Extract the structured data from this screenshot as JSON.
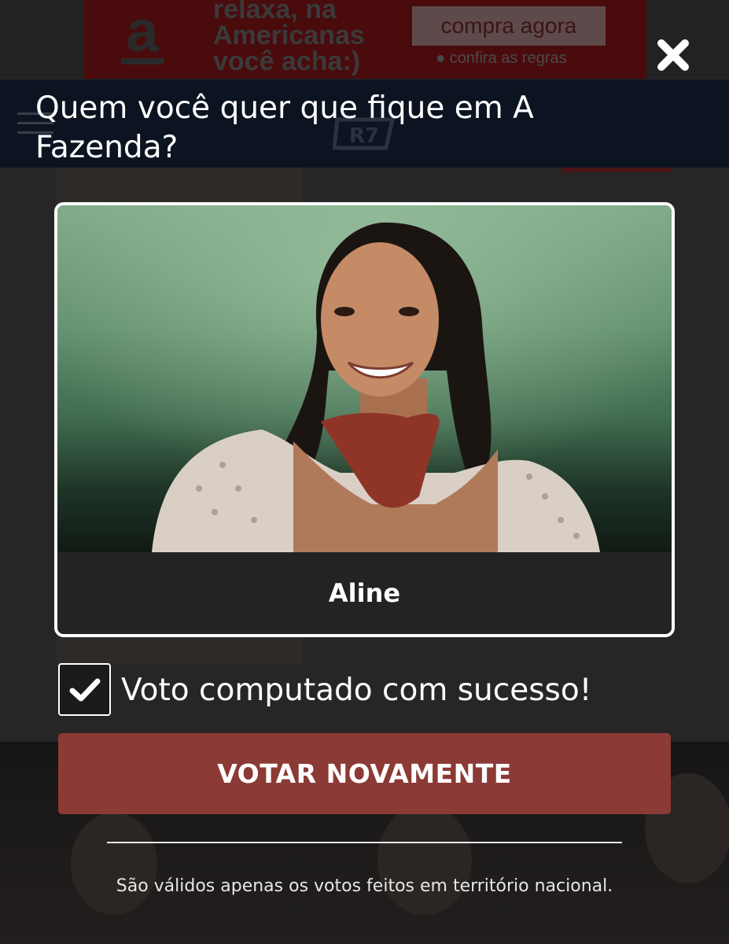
{
  "background_ad": {
    "logo_letter": "a",
    "text": "relaxa, na Americanas você acha:)",
    "cta_label": "compra agora",
    "rules_text": "confira as regras"
  },
  "modal": {
    "title": "Quem você quer que fique em A Fazenda?",
    "close_icon": "close-x-icon",
    "candidate": {
      "name": "Aline",
      "photo_description_icon": "portrait-photo"
    },
    "status": {
      "checked": true,
      "message": "Voto computado com sucesso!"
    },
    "vote_again_label": "VOTAR NOVAMENTE",
    "disclaimer": "São válidos apenas os votos feitos em território nacional."
  },
  "colors": {
    "title_bar": "#0c1421",
    "button": "#8c3a35",
    "card_border": "#ffffff",
    "photo_background": "#6f9b7b"
  }
}
